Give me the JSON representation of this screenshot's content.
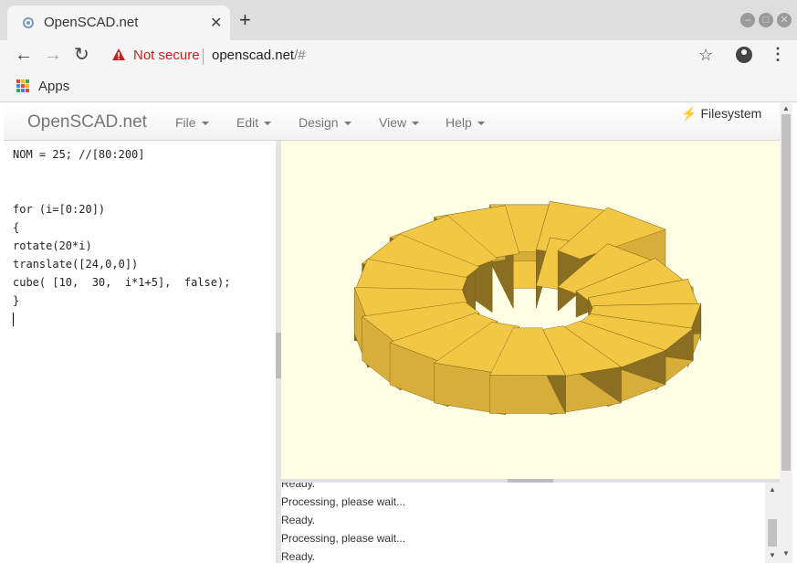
{
  "browser": {
    "tab_title": "OpenSCAD.net",
    "tab_close": "✕",
    "new_tab": "+",
    "security_label": "Not secure",
    "url_host": "openscad.net",
    "url_path": "/#",
    "bookmark_apps": "Apps",
    "icons": [
      "back-arrow-icon",
      "forward-arrow-icon",
      "reload-icon",
      "warning-icon",
      "star-icon",
      "account-icon",
      "kebab-menu-icon",
      "apps-grid-icon"
    ]
  },
  "app": {
    "brand": "OpenSCAD.net",
    "menus": [
      "File",
      "Edit",
      "Design",
      "View",
      "Help"
    ],
    "filesystem_label": "Filesystem"
  },
  "editor": {
    "lines": [
      "NOM = 25; //[80:200]",
      "",
      "",
      "for (i=[0:20])",
      "{",
      "rotate(20*i)",
      "translate([24,0,0])",
      "cube( [10,  30,  i*1+5],  false);",
      "}"
    ]
  },
  "console": {
    "lines": [
      "Ready.",
      "Processing, please wait...",
      "Ready.",
      "Processing, please wait...",
      "Ready."
    ]
  },
  "colors": {
    "viewer_bg": "#ffffe5",
    "model_top": "#f2c743",
    "model_side_light": "#d8ae3a",
    "model_side_dark": "#8a6f22",
    "security_red": "#c5221f"
  }
}
